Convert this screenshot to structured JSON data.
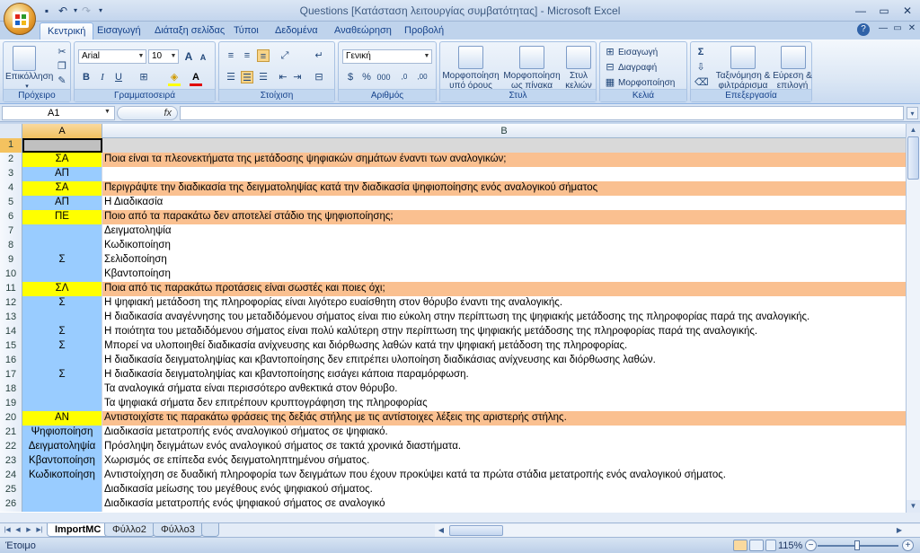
{
  "window": {
    "title": "Questions  [Κατάσταση λειτουργίας συμβατότητας] - Microsoft Excel",
    "minimize": "—",
    "maximize": "▭",
    "close": "✕",
    "help": "?",
    "doc_min": "—",
    "doc_restore": "▭",
    "doc_close": "✕"
  },
  "quick_access": {
    "save_icon": "save-icon",
    "undo_icon": "undo-icon",
    "redo_icon": "redo-icon"
  },
  "tabs": [
    "Κεντρική",
    "Εισαγωγή",
    "Διάταξη σελίδας",
    "Τύποι",
    "Δεδομένα",
    "Αναθεώρηση",
    "Προβολή"
  ],
  "active_tab": "Κεντρική",
  "ribbon": {
    "clipboard": {
      "title": "Πρόχειρο",
      "paste": "Επικόλληση"
    },
    "font": {
      "title": "Γραμματοσειρά",
      "name": "Arial",
      "size": "10",
      "bold": "B",
      "italic": "I",
      "underline": "U",
      "grow": "A",
      "shrink": "A"
    },
    "alignment": {
      "title": "Στοίχιση"
    },
    "number": {
      "title": "Αριθμός",
      "format": "Γενική",
      "currency": "$",
      "percent": "%",
      "comma": "000",
      "inc_dec": ",0",
      "dec_dec": ",00"
    },
    "styles": {
      "title": "Στυλ",
      "cond": "Μορφοποίηση",
      "cond2": "υπό όρους",
      "table": "Μορφοποίηση",
      "table2": "ως πίνακα",
      "cell": "Στυλ",
      "cell2": "κελιών"
    },
    "cells": {
      "title": "Κελιά",
      "insert": "Εισαγωγή",
      "delete": "Διαγραφή",
      "format": "Μορφοποίηση"
    },
    "editing": {
      "title": "Επεξεργασία",
      "sum": "Σ",
      "sort": "Ταξινόμηση &",
      "sort2": "φιλτράρισμα",
      "find": "Εύρεση &",
      "find2": "επιλογή"
    }
  },
  "name_box": "A1",
  "fx": "fx",
  "columns": [
    "A",
    "B"
  ],
  "rows": [
    {
      "n": "1",
      "a": "",
      "b": ""
    },
    {
      "n": "2",
      "a": "ΣΑ",
      "b": "Ποια είναι τα πλεονεκτήματα της μετάδοσης ψηφιακών σημάτων έναντι των αναλογικών;"
    },
    {
      "n": "3",
      "a": "ΑΠ",
      "b": ""
    },
    {
      "n": "4",
      "a": "ΣΑ",
      "b": "Περιγράψτε την διαδικασία της δειγματοληψίας κατά την διαδικασία ψηφιοποίησης ενός αναλογικού σήματος"
    },
    {
      "n": "5",
      "a": "ΑΠ",
      "b": "Η Διαδικασία"
    },
    {
      "n": "6",
      "a": "ΠΕ",
      "b": "Ποιο από τα παρακάτω δεν αποτελεί στάδιο της ψηφιοποίησης;"
    },
    {
      "n": "7",
      "a": "",
      "b": "Δειγματοληψία"
    },
    {
      "n": "8",
      "a": "",
      "b": "Κωδικοποίηση"
    },
    {
      "n": "9",
      "a": "Σ",
      "b": "Σελιδοποίηση"
    },
    {
      "n": "10",
      "a": "",
      "b": "Κβαντοποίηση"
    },
    {
      "n": "11",
      "a": "ΣΛ",
      "b": "Ποια από τις παρακάτω προτάσεις είναι σωστές και ποιες όχι;"
    },
    {
      "n": "12",
      "a": "Σ",
      "b": "Η ψηφιακή μετάδοση της πληροφορίας είναι λιγότερο ευαίσθητη στον θόρυβο έναντι της αναλογικής."
    },
    {
      "n": "13",
      "a": "",
      "b": "Η διαδικασία αναγέννησης του μεταδιδόμενου σήματος είναι πιο εύκολη στην περίπτωση της ψηφιακής μετάδοσης της πληροφορίας παρά της αναλογικής."
    },
    {
      "n": "14",
      "a": "Σ",
      "b": "Η ποιότητα του μεταδιδόμενου σήματος είναι πολύ καλύτερη στην περίπτωση της ψηφιακής μετάδοσης της πληροφορίας παρά της αναλογικής."
    },
    {
      "n": "15",
      "a": "Σ",
      "b": "Μπορεί να υλοποιηθεί διαδικασία ανίχνευσης και διόρθωσης λαθών κατά την ψηφιακή μετάδοση της πληροφορίας."
    },
    {
      "n": "16",
      "a": "",
      "b": "Η διαδικασία δειγματοληψίας και κβαντοποίησης δεν επιτρέπει υλοποίηση διαδικάσιας ανίχνευσης και διόρθωσης λαθών."
    },
    {
      "n": "17",
      "a": "Σ",
      "b": "Η διαδικασία δειγματοληψίας και κβαντοποίησης εισάγει κάποια παραμόρφωση."
    },
    {
      "n": "18",
      "a": "",
      "b": "Τα αναλογικά σήματα είναι περισσότερο ανθεκτικά στον θόρυβο."
    },
    {
      "n": "19",
      "a": "",
      "b": "Τα ψηφιακά σήματα δεν επιτρέπουν κρυπτογράφηση της πληροφορίας"
    },
    {
      "n": "20",
      "a": "ΑΝ",
      "b": "Αντιστοιχίστε τις παρακάτω φράσεις της δεξιάς στήλης με τις αντίστοιχες λέξεις της αριστερής στήλης."
    },
    {
      "n": "21",
      "a": "Ψηφιοποίηση",
      "b": "Διαδικασία μετατροπής ενός αναλογικού σήματος σε ψηφιακό."
    },
    {
      "n": "22",
      "a": "Δειγματοληψία",
      "b": "Πρόσληψη δειγμάτων ενός αναλογικού σήματος σε τακτά χρονικά διαστήματα."
    },
    {
      "n": "23",
      "a": "Κβαντοποίηση",
      "b": "Χωρισμός σε επίπεδα ενός δειγματοληπτημένου σήματος."
    },
    {
      "n": "24",
      "a": "Κωδικοποίηση",
      "b": "Αντιστοίχηση σε δυαδική πληροφορία των δειγμάτων που έχουν προκύψει κατά τα πρώτα στάδια μετατροπής ενός αναλογικού σήματος."
    },
    {
      "n": "25",
      "a": "",
      "b": "Διαδικασία μείωσης του μεγέθους ενός ψηφιακού σήματος."
    },
    {
      "n": "26",
      "a": "",
      "b": "Διαδικασία μετατροπής ενός ψηφιακού σήματος σε αναλογικό"
    }
  ],
  "sheets": [
    "ImportMC",
    "Φύλλο2",
    "Φύλλο3"
  ],
  "active_sheet": "ImportMC",
  "status": "Έτοιμο",
  "zoom": "115%",
  "colors": {
    "yellow": "#ffff00",
    "orange": "#fac090",
    "blue": "#99ccff",
    "selected": "#c0c0c0"
  }
}
